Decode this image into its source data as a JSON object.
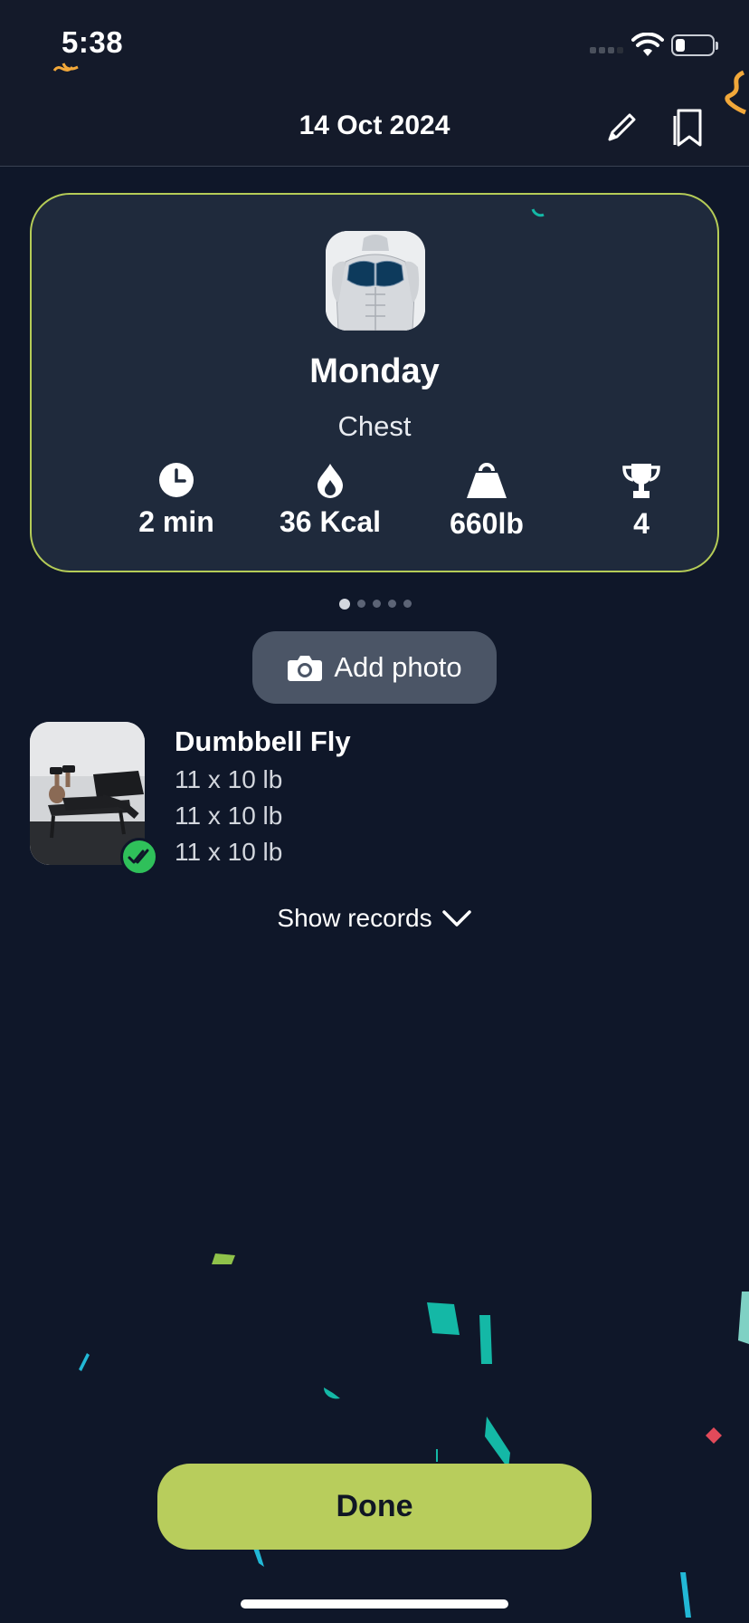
{
  "status_bar": {
    "time": "5:38"
  },
  "header": {
    "title": "14 Oct 2024",
    "edit_icon": "pencil-icon",
    "bookmark_icon": "bookmark-icon"
  },
  "summary": {
    "day": "Monday",
    "muscle_group": "Chest",
    "stats": [
      {
        "icon": "clock-icon",
        "value": "2 min"
      },
      {
        "icon": "flame-icon",
        "value": "36 Kcal"
      },
      {
        "icon": "weight-icon",
        "value": "660lb"
      },
      {
        "icon": "trophy-icon",
        "value": "4"
      }
    ],
    "pages": 5,
    "active_page": 1
  },
  "add_photo": {
    "label": "Add photo",
    "icon": "camera-icon"
  },
  "exercise": {
    "name": "Dumbbell Fly",
    "sets": [
      "11 x 10 lb",
      "11 x 10 lb",
      "11 x 10 lb"
    ],
    "completed": true
  },
  "show_records": {
    "label": "Show records"
  },
  "done_button": {
    "label": "Done"
  },
  "colors": {
    "background": "#0f1729",
    "card": "#1f2a3c",
    "accent": "#b8cd5c",
    "success": "#2fc05a",
    "confetti": [
      "#14b8a6",
      "#8fc24a",
      "#e24a5a",
      "#22b8d6"
    ]
  }
}
